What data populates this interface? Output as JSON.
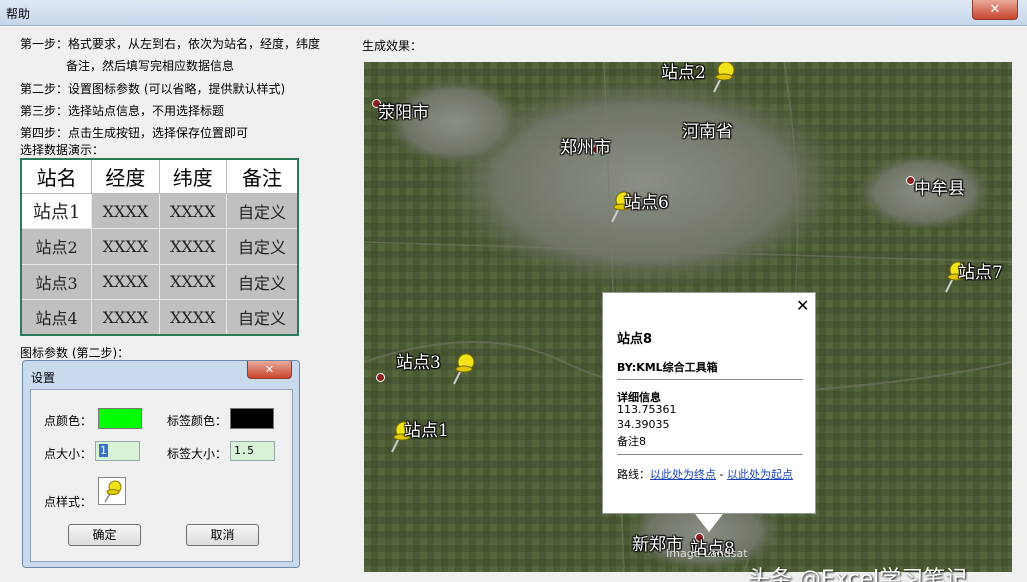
{
  "window": {
    "title": "帮助",
    "close_label": "✕"
  },
  "steps": {
    "step1_line1": "第一步：格式要求，从左到右，依次为站名，经度，纬度",
    "step1_line2": "备注，然后填写完相应数据信息",
    "step2": "第二步：设置图标参数 (可以省略，提供默认样式)",
    "step3": "第三步：选择站点信息，不用选择标题",
    "step4": "第四步：点击生成按钮，选择保存位置即可"
  },
  "data_demo": {
    "label": "选择数据演示：",
    "columns": [
      "站名",
      "经度",
      "纬度",
      "备注"
    ],
    "rows": [
      [
        "站点1",
        "XXXX",
        "XXXX",
        "自定义"
      ],
      [
        "站点2",
        "XXXX",
        "XXXX",
        "自定义"
      ],
      [
        "站点3",
        "XXXX",
        "XXXX",
        "自定义"
      ],
      [
        "站点4",
        "XXXX",
        "XXXX",
        "自定义"
      ]
    ]
  },
  "icon_params_label": "图标参数 (第二步)：",
  "result_label": "生成效果：",
  "settings_dialog": {
    "title": "设置",
    "close_label": "✕",
    "point_color_label": "点颜色：",
    "point_color": "#00ff00",
    "label_color_label": "标签颜色：",
    "label_color": "#000000",
    "point_size_label": "点大小：",
    "point_size": "1",
    "label_size_label": "标签大小：",
    "label_size": "1.5",
    "point_style_label": "点样式：",
    "ok_label": "确定",
    "cancel_label": "取消"
  },
  "map": {
    "labels": {
      "xingyang": "荥阳市",
      "zhengzhou": "郑州市",
      "henan": "河南省",
      "zhongmou": "中牟县",
      "xinzheng": "新郑市",
      "station2": "站点2",
      "station6": "站点6",
      "station7": "站点7",
      "station3": "站点3",
      "station1": "站点1",
      "station8": "站点8"
    },
    "popup": {
      "title": "站点8",
      "by": "BY:KML综合工具箱",
      "detail_heading": "详细信息",
      "longitude": "113.75361",
      "latitude": "34.39035",
      "note": "备注8",
      "route_prefix": "路线：",
      "route_to": "以此处为终点",
      "route_sep": " - ",
      "route_from": "以此处为起点",
      "close_label": "✕"
    },
    "image_credit": "Image Landsat",
    "watermark": "头条 @Excel学习笔记"
  },
  "colors": {
    "pin": "#f2e21a",
    "accent_border": "#2d7a5a"
  }
}
